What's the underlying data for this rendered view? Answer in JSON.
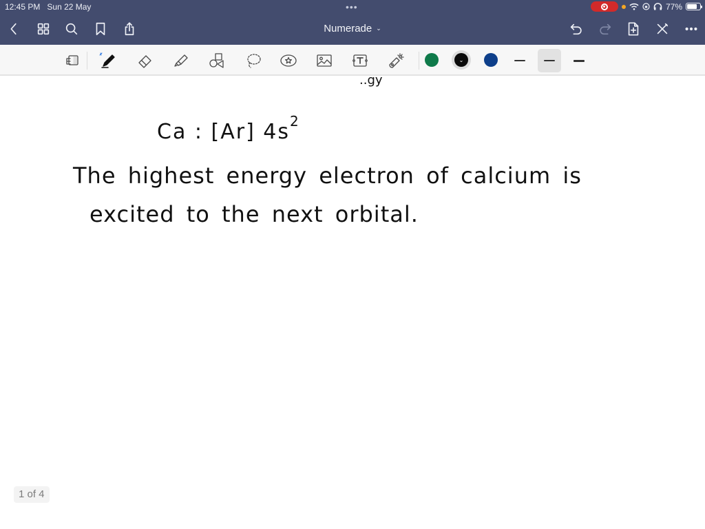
{
  "status_bar": {
    "time": "12:45 PM",
    "date": "Sun 22 May",
    "battery": "77%",
    "battery_level": 0.77,
    "icons": [
      "screen-record-icon",
      "mic-in-use-dot",
      "wifi-icon",
      "orientation-lock-icon",
      "headphones-icon",
      "battery-icon"
    ]
  },
  "nav": {
    "title": "Numerade",
    "title_chevron": "⌄",
    "left_icons": [
      "back-icon",
      "grid-icon",
      "search-icon",
      "bookmark-icon",
      "share-icon"
    ],
    "right_icons": [
      "undo-icon",
      "redo-icon",
      "add-page-icon",
      "close-pen-icon",
      "more-icon"
    ]
  },
  "toolbar": {
    "tools": [
      "reader-mode",
      "pen",
      "eraser",
      "highlighter",
      "shapes",
      "lasso",
      "sticker",
      "image",
      "text",
      "laser-pointer"
    ],
    "active_tool": "pen",
    "colors": [
      {
        "name": "green",
        "hex": "#0f7a4a"
      },
      {
        "name": "black",
        "hex": "#0a0a0a",
        "selected": true
      },
      {
        "name": "blue",
        "hex": "#0e3f8a"
      }
    ],
    "stroke_widths": [
      "thin",
      "medium",
      "thick"
    ],
    "selected_stroke": "medium"
  },
  "canvas": {
    "partial_top": "..gy",
    "line1": "Ca  :   [Ar] 4s",
    "line1_superscript": "2",
    "line2": "The  highest  energy  electron  of  calcium  is",
    "line3": "excited  to  the  next  orbital."
  },
  "page_indicator": "1 of 4"
}
